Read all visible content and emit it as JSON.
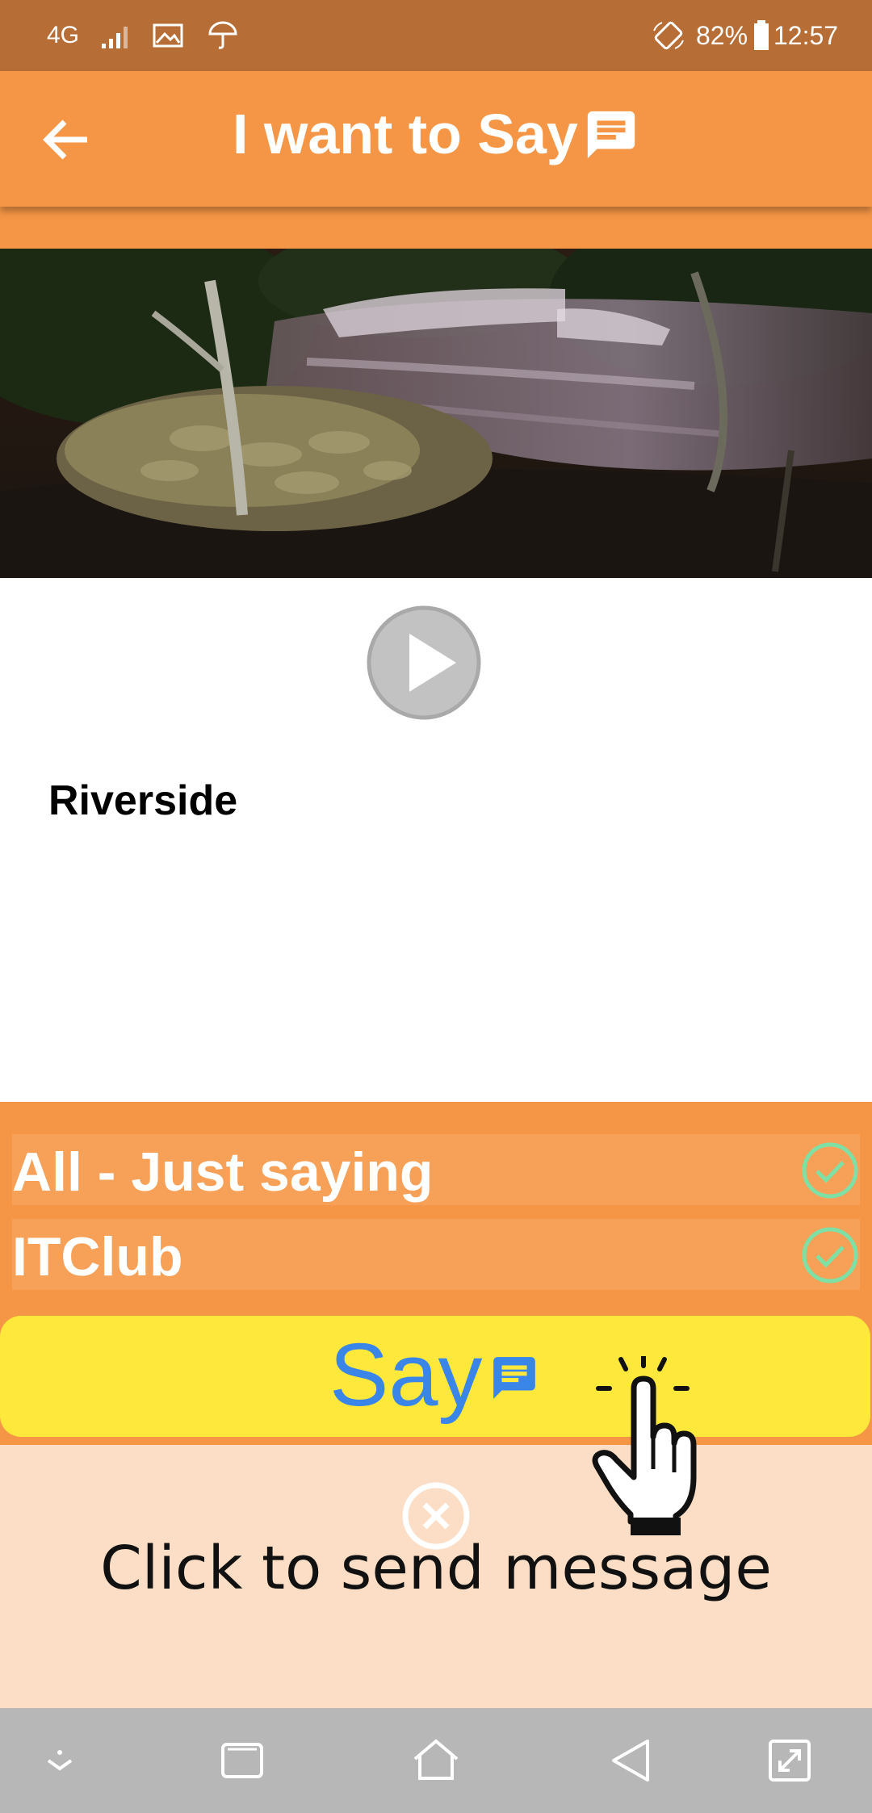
{
  "status_bar": {
    "network": "4G",
    "battery": "82%",
    "time": "12:57",
    "icons": [
      "signal-icon",
      "gallery-icon",
      "weather-icon",
      "rotate-icon",
      "battery-icon"
    ]
  },
  "app_bar": {
    "title": "I want to Say",
    "back_icon": "arrow-left-icon",
    "title_icon": "chat-icon"
  },
  "media": {
    "image_subject": "night river rapids",
    "play_icon": "play-icon"
  },
  "location": {
    "title": "Riverside"
  },
  "groups": [
    {
      "label": "All - Just saying",
      "checked": true
    },
    {
      "label": "ITClub",
      "checked": true
    }
  ],
  "say_button": {
    "label": "Say",
    "icon": "chat-icon"
  },
  "tip": {
    "text": "Click to send message",
    "close_icon": "close-circle-icon",
    "pointer_icon": "hand-pointer-icon"
  },
  "nav_bar": {
    "icons": [
      "hide-keyboard-icon",
      "recents-icon",
      "home-icon",
      "back-icon",
      "expand-icon"
    ]
  },
  "colors": {
    "primary": "#f59646",
    "status_bar": "#b76d36",
    "say_button": "#fde83b",
    "say_text": "#3a86e8",
    "check": "#7fe0a5",
    "tip_bg": "#fbdec5",
    "nav_bar": "#b7b7b7"
  }
}
